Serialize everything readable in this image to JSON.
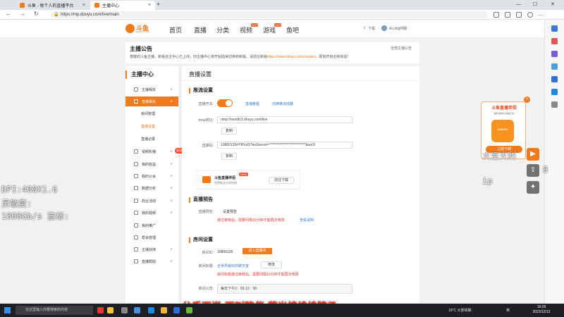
{
  "browser": {
    "tabs": [
      {
        "label": "斗鱼 - 每个人的直播平台",
        "active": false
      },
      {
        "label": "主播中心",
        "active": true
      }
    ],
    "url": "https://mp.douyu.com/live/main"
  },
  "header": {
    "logo_text": "斗鱼",
    "logo_sub": "DOUYU.COM",
    "nav": [
      "首页",
      "直播",
      "分类",
      "视频",
      "游戏",
      "鱼吧"
    ],
    "hot_badge": "HOT",
    "download": "下载",
    "username": "ALuNg阿聊"
  },
  "notice": {
    "title": "主播公告",
    "close": "全部主播公告",
    "body": "尊敬的斗鱼主播，新版自主中心已上线，旧主播中心将开始陆续切换到新版。请前往新版",
    "link": "https://www.douyu.com/creator",
    "tail": "，即刻开启全新体验！"
  },
  "sidebar": {
    "title": "主播中心",
    "items": [
      {
        "label": "主播相关",
        "arrow": "∨"
      },
      {
        "label": "直播相关",
        "arrow": "∧"
      },
      {
        "label": "视频轮播",
        "arrow": "∨"
      },
      {
        "label": "我的收益",
        "arrow": "∨"
      },
      {
        "label": "我的公会",
        "arrow": "∨"
      },
      {
        "label": "数据分析",
        "arrow": "∨"
      },
      {
        "label": "商业活动",
        "arrow": "∨"
      },
      {
        "label": "我的视频",
        "arrow": "∨"
      },
      {
        "label": "我的推广",
        "arrow": ""
      },
      {
        "label": "帮会管理",
        "arrow": ""
      },
      {
        "label": "主播扶持",
        "arrow": "∨"
      },
      {
        "label": "直播帮助",
        "arrow": "∨"
      }
    ],
    "subitems": [
      "房间管理",
      "直播设置",
      "直播记录"
    ],
    "new_badge": "新功能"
  },
  "main": {
    "title": "直播设置",
    "push": {
      "heading": "推流设置",
      "switch_label": "直播开关:",
      "tutorial_link": "直播教程",
      "rtmp_link": "切换推流线路",
      "rtmp_label": "rtmp地址:",
      "rtmp_value": "rtmp://sendtc3.douyu.com/live",
      "copy1": "复制",
      "code_label": "直播码:",
      "code_value": "10860135rfYRVzG?wsSecret=***************************&wsTi",
      "copy2": "复制"
    },
    "companion": {
      "title": "斗鱼直播伴侣",
      "new": "NEW",
      "subtitle": "免费推送方便快捷",
      "button": "前往下载"
    },
    "preview": {
      "heading": "直播预告",
      "label": "直播预告:",
      "value": "设置预告",
      "warning": "通过审核后，需要间隔10分钟才能再次修改",
      "warning_link": "查看说明"
    },
    "room": {
      "heading": "房间设置",
      "id_label": "房间ID:",
      "id_value": "10860135",
      "enter_button": "进入直播间",
      "title_label": "房间标题:",
      "title_value": "全世界最好的聊天室",
      "edit_button": "修改",
      "title_warning": "房间标题通过审核后，需要间隔10分钟才能再次修改",
      "notice_label": "房间公告:",
      "notice_value": "每日下午2：00-12：00"
    }
  },
  "ad": {
    "title": "斗鱼直播伴侣",
    "subtitle": "超好用的PC直播工具",
    "app_text": "DOUYU",
    "button": "立即下载"
  },
  "overlays": {
    "left": [
      "DPI:400X1.6",
      "灵敏度:",
      "1800Gb/s 鼠标:"
    ],
    "right": [
      "大吉大利",
      "8",
      "ip"
    ],
    "caption": "分手不说 不叫陪伴 荧光棒续续牌子"
  },
  "taskbar": {
    "search": "在这里输入你要搜索的内容",
    "weather": "18°C  大部晴朗",
    "ime": "英",
    "time": "19:29",
    "date": "2022/12/12"
  }
}
